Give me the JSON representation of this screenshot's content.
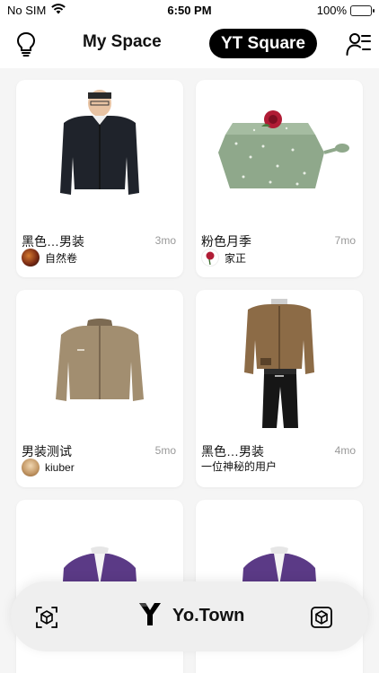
{
  "status_bar": {
    "carrier": "No SIM",
    "time": "6:50 PM",
    "battery": "100%"
  },
  "header": {
    "tab_my_space": "My Space",
    "tab_yt_square": "YT Square"
  },
  "feed": [
    {
      "title": "黑色…男装",
      "time": "3mo",
      "author": "自然卷"
    },
    {
      "title": "粉色月季",
      "time": "7mo",
      "author": "家正"
    },
    {
      "title": "男装测试",
      "time": "5mo",
      "author": "kiuber"
    },
    {
      "title": "黑色…男装",
      "time": "4mo",
      "author": "一位神秘的用户"
    }
  ],
  "bottom_bar": {
    "brand": "Yo.Town"
  },
  "colors": {
    "accent": "#000000",
    "battery_green": "#34c759",
    "background": "#f5f5f5"
  },
  "icons": [
    "wifi-icon",
    "lightbulb-icon",
    "profile-list-icon",
    "box-scan-icon",
    "box-upload-icon",
    "yotown-logo-icon"
  ]
}
